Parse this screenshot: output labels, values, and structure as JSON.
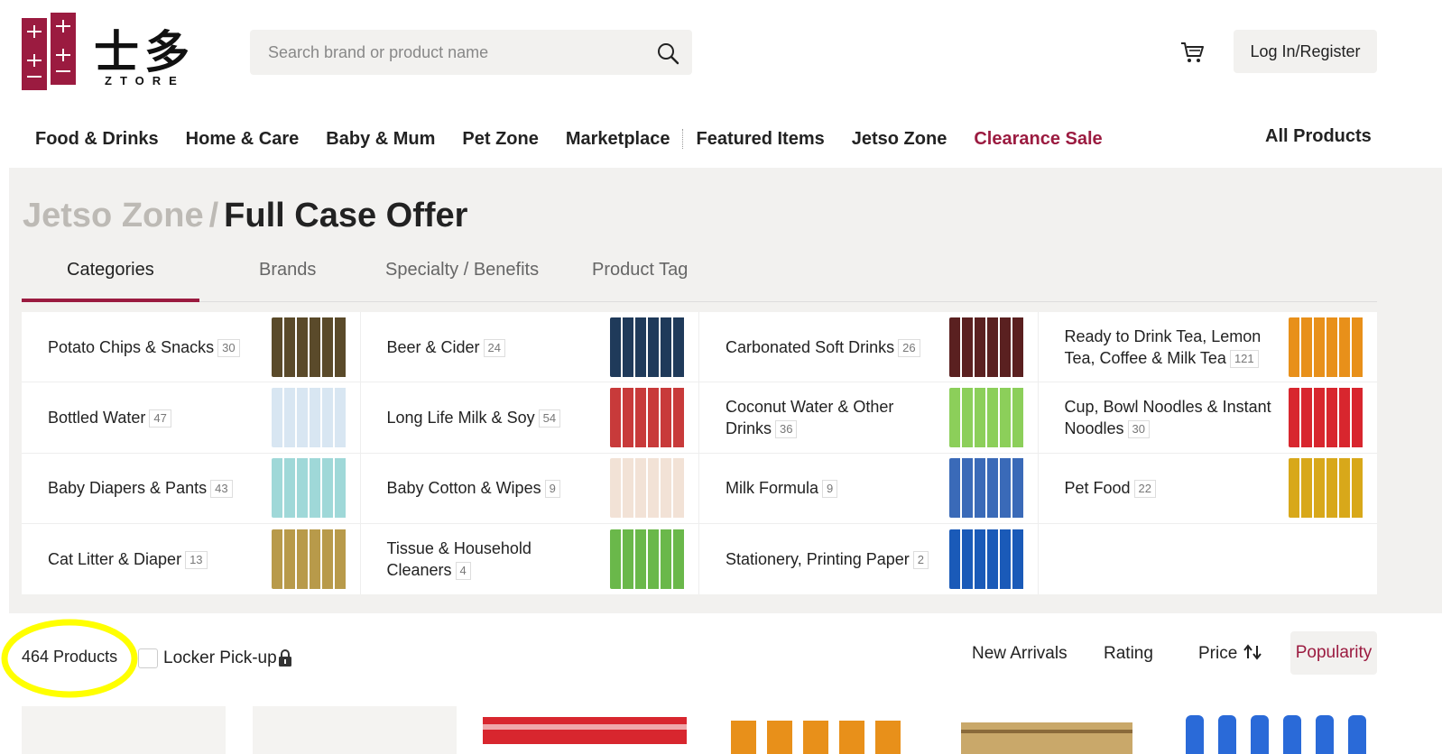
{
  "brand": {
    "name_cn": "士多",
    "name_en": "ZTORE"
  },
  "search": {
    "placeholder": "Search brand or product name"
  },
  "header": {
    "login_label": "Log In/Register"
  },
  "nav": {
    "items": [
      "Food & Drinks",
      "Home & Care",
      "Baby & Mum",
      "Pet Zone",
      "Marketplace",
      "Featured Items",
      "Jetso Zone",
      "Clearance Sale"
    ],
    "all_products": "All Products"
  },
  "breadcrumb": {
    "parent": "Jetso Zone",
    "separator": "/",
    "current": "Full Case Offer"
  },
  "tabs": [
    "Categories",
    "Brands",
    "Specialty / Benefits",
    "Product Tag"
  ],
  "categories": [
    {
      "name": "Potato Chips & Snacks",
      "count": "30",
      "thumb_color": "#5a4a2a"
    },
    {
      "name": "Beer & Cider",
      "count": "24",
      "thumb_color": "#1f3a5a"
    },
    {
      "name": "Carbonated Soft Drinks",
      "count": "26",
      "thumb_color": "#5a2020"
    },
    {
      "name": "Ready to Drink Tea, Lemon Tea, Coffee & Milk Tea",
      "count": "121",
      "thumb_color": "#e8901a"
    },
    {
      "name": "Bottled Water",
      "count": "47",
      "thumb_color": "#d8e6f2"
    },
    {
      "name": "Long Life Milk & Soy",
      "count": "54",
      "thumb_color": "#c83a3a"
    },
    {
      "name": "Coconut Water & Other Drinks",
      "count": "36",
      "thumb_color": "#8ccf5a"
    },
    {
      "name": "Cup, Bowl Noodles & Instant Noodles",
      "count": "30",
      "thumb_color": "#d8262e"
    },
    {
      "name": "Baby Diapers & Pants",
      "count": "43",
      "thumb_color": "#9fd8d8"
    },
    {
      "name": "Baby Cotton & Wipes",
      "count": "9",
      "thumb_color": "#f2e2d6"
    },
    {
      "name": "Milk Formula",
      "count": "9",
      "thumb_color": "#3a6ab8"
    },
    {
      "name": "Pet Food",
      "count": "22",
      "thumb_color": "#d8a81a"
    },
    {
      "name": "Cat Litter & Diaper",
      "count": "13",
      "thumb_color": "#b89a4a"
    },
    {
      "name": "Tissue & Household Cleaners",
      "count": "4",
      "thumb_color": "#6ab84a"
    },
    {
      "name": "Stationery, Printing Paper",
      "count": "2",
      "thumb_color": "#1a5ab8"
    },
    {
      "name": "",
      "count": "",
      "thumb_color": ""
    }
  ],
  "filters": {
    "total": "464 Products",
    "locker_label": "Locker Pick-up",
    "sort": [
      "New Arrivals",
      "Rating",
      "Price",
      "Popularity"
    ],
    "sort_active": "Popularity"
  },
  "colors": {
    "accent": "#9b1b40",
    "panel_bg": "#f2f1ef",
    "highlight": "#ffff00"
  },
  "icons": [
    "search-icon",
    "cart-icon",
    "lock-icon",
    "sort-arrows-icon"
  ]
}
